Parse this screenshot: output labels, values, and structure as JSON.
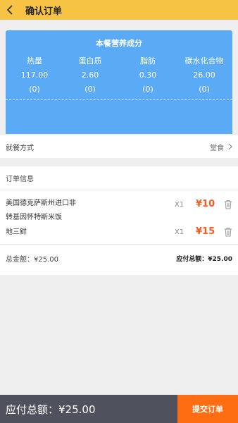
{
  "header": {
    "title": "确认订单"
  },
  "nutrition": {
    "title": "本餐营养成分",
    "columns": [
      {
        "label": "热量",
        "value": "117.00",
        "sub": "(0)"
      },
      {
        "label": "蛋白质",
        "value": "2.60",
        "sub": "(0)"
      },
      {
        "label": "脂肪",
        "value": "0.30",
        "sub": "(0)"
      },
      {
        "label": "碳水化合物",
        "value": "26.00",
        "sub": "(0)"
      }
    ]
  },
  "dining": {
    "label": "就餐方式",
    "value": "堂食"
  },
  "order": {
    "title": "订单信息",
    "items": [
      {
        "name": "美国德克萨斯州进口非转基因怀特斯米饭",
        "line1": "美国德克萨斯州进口非",
        "line2": "转基因怀特斯米饭",
        "qty": "X1",
        "price": "¥10"
      },
      {
        "name": "地三鲜",
        "line1": "地三鲜",
        "line2": "",
        "qty": "X1",
        "price": "¥15"
      }
    ],
    "total_label": "总金额：¥25.00",
    "payable_label": "应付总额：¥25.00"
  },
  "footer": {
    "total": "应付总额：¥25.00",
    "submit": "提交订单"
  }
}
